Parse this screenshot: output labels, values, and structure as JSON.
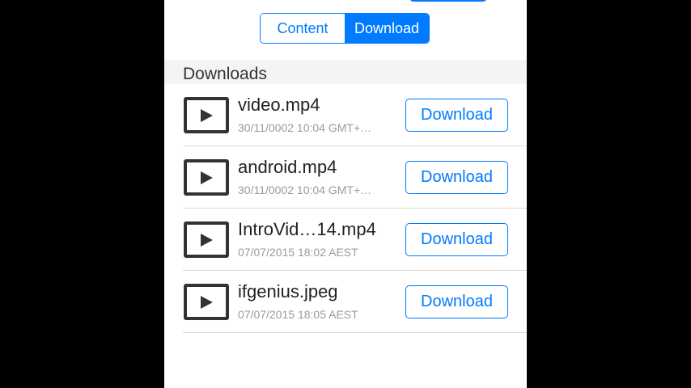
{
  "tabs": {
    "content_label": "Content",
    "download_label": "Download",
    "selected": "Download"
  },
  "section": {
    "title": "Downloads"
  },
  "colors": {
    "accent": "#007aff",
    "text": "#222222",
    "subtext": "#9a9a9a",
    "section_bg": "#f4f4f4"
  },
  "downloads": [
    {
      "name": "video.mp4",
      "date": "30/11/0002 10:04 GMT+…",
      "icon": "play-icon",
      "button_label": "Download"
    },
    {
      "name": "android.mp4",
      "date": "30/11/0002 10:04 GMT+…",
      "icon": "play-icon",
      "button_label": "Download"
    },
    {
      "name": "IntroVid…14.mp4",
      "date": "07/07/2015 18:02 AEST",
      "icon": "play-icon",
      "button_label": "Download"
    },
    {
      "name": "ifgenius.jpeg",
      "date": "07/07/2015 18:05 AEST",
      "icon": "play-icon",
      "button_label": "Download"
    }
  ]
}
